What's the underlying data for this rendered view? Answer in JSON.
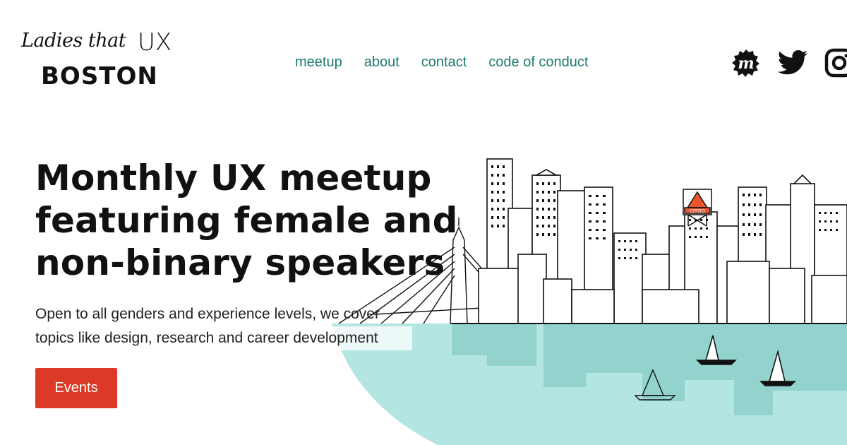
{
  "header": {
    "logo": {
      "script_text": "Ladies that",
      "ux_text": "UX",
      "city_text": "BOSTON"
    },
    "nav": [
      {
        "label": "meetup"
      },
      {
        "label": "about"
      },
      {
        "label": "contact"
      },
      {
        "label": "code of conduct"
      }
    ],
    "social": [
      {
        "icon": "meetup-icon",
        "glyph": "m"
      },
      {
        "icon": "twitter-icon"
      },
      {
        "icon": "instagram-icon"
      }
    ]
  },
  "hero": {
    "title_lines": [
      "Monthly UX meetup",
      "featuring female and",
      "non-binary speakers"
    ],
    "subtitle_lines": [
      "Open to all genders and experience levels, we cover",
      "topics like design, research and career development"
    ],
    "cta_label": "Events",
    "illustration": {
      "sign_text": "CITGO"
    }
  },
  "colors": {
    "nav_link": "#1f7a70",
    "cta": "#dc3a26",
    "water": "#b3e5e3",
    "water_reflection": "#92d3ce",
    "sign": "#e8542e"
  }
}
